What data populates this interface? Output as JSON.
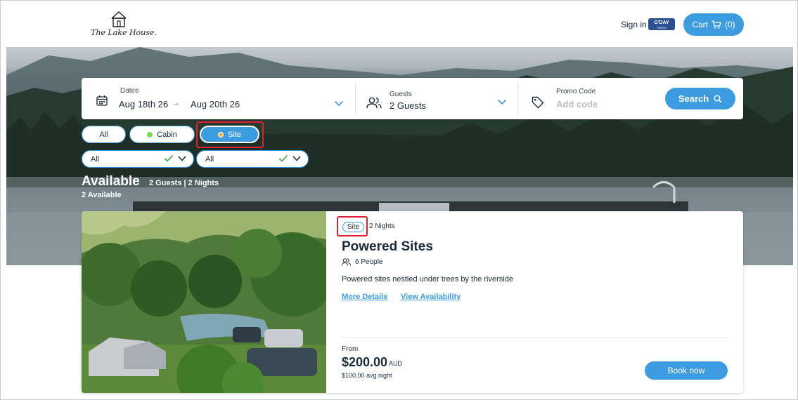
{
  "header": {
    "logo_text": "The Lake House.",
    "sign_in_label": "Sign in",
    "partner_badge": {
      "main": "G'DAY",
      "sub": "PARKS"
    },
    "cart_label": "Cart",
    "cart_count": "(0)"
  },
  "search": {
    "dates_label": "Dates",
    "date_from": "Aug 18th 26",
    "arrow": "→",
    "date_to": "Aug 20th 26",
    "guests_label": "Guests",
    "guests_value": "2 Guests",
    "promo_label": "Promo Code",
    "promo_placeholder": "Add code",
    "search_label": "Search"
  },
  "filters": {
    "type_pills": [
      {
        "label": "All"
      },
      {
        "label": "Cabin",
        "dot_color": "#7ed957"
      },
      {
        "label": "Site",
        "dot_color": "#f2b33d",
        "selected": true
      }
    ],
    "selects": [
      {
        "value": "All"
      },
      {
        "value": "All"
      }
    ]
  },
  "availability": {
    "title": "Available",
    "meta": "2 Guests | 2 Nights",
    "count": "2 Available"
  },
  "card": {
    "badge": "Site",
    "nights": "2 Nights",
    "title": "Powered Sites",
    "people": "6 People",
    "description": "Powered sites nestled under trees by the riverside",
    "more_details": "More Details",
    "view_availability": "View Availability",
    "from_label": "From",
    "price": "$200.00",
    "currency": "AUD",
    "avg_night": "$100.00 avg night",
    "book_label": "Book now"
  },
  "colors": {
    "accent": "#3d9be0",
    "highlight": "#e0202f",
    "check": "#3aa54a"
  }
}
